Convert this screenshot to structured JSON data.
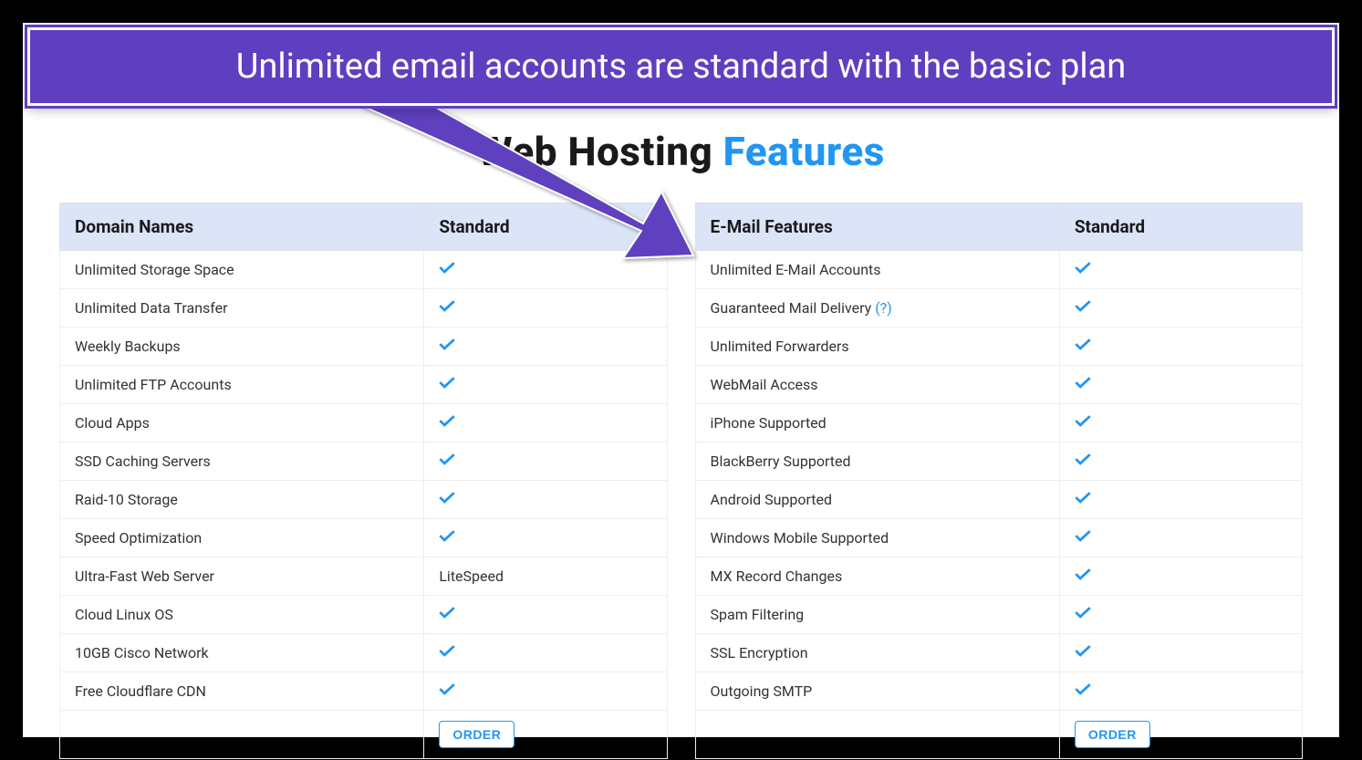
{
  "callout": {
    "text": "Unlimited email accounts are standard with the basic plan"
  },
  "title": {
    "part1": "Web Hosting ",
    "part2": "Features"
  },
  "help_token": "(?)",
  "tables": {
    "left": {
      "header_feature": "Domain Names",
      "header_plan": "Standard",
      "rows": [
        {
          "label": "Unlimited Storage Space",
          "value_type": "check",
          "value": ""
        },
        {
          "label": "Unlimited Data Transfer",
          "value_type": "check",
          "value": ""
        },
        {
          "label": "Weekly Backups",
          "value_type": "check",
          "value": ""
        },
        {
          "label": "Unlimited FTP Accounts",
          "value_type": "check",
          "value": ""
        },
        {
          "label": "Cloud Apps",
          "value_type": "check",
          "value": ""
        },
        {
          "label": "SSD Caching Servers",
          "value_type": "check",
          "value": ""
        },
        {
          "label": "Raid-10 Storage",
          "value_type": "check",
          "value": ""
        },
        {
          "label": "Speed Optimization",
          "value_type": "check",
          "value": ""
        },
        {
          "label": "Ultra-Fast Web Server",
          "value_type": "text",
          "value": "LiteSpeed"
        },
        {
          "label": "Cloud Linux OS",
          "value_type": "check",
          "value": ""
        },
        {
          "label": "10GB Cisco Network",
          "value_type": "check",
          "value": ""
        },
        {
          "label": "Free Cloudflare CDN",
          "value_type": "check",
          "value": ""
        }
      ],
      "order_label": "ORDER"
    },
    "right": {
      "header_feature": "E-Mail Features",
      "header_plan": "Standard",
      "rows": [
        {
          "label": "Unlimited E-Mail Accounts",
          "value_type": "check",
          "value": "",
          "has_help": false
        },
        {
          "label": "Guaranteed Mail Delivery ",
          "value_type": "check",
          "value": "",
          "has_help": true
        },
        {
          "label": "Unlimited Forwarders",
          "value_type": "check",
          "value": "",
          "has_help": false
        },
        {
          "label": "WebMail Access",
          "value_type": "check",
          "value": "",
          "has_help": false
        },
        {
          "label": "iPhone Supported",
          "value_type": "check",
          "value": "",
          "has_help": false
        },
        {
          "label": "BlackBerry Supported",
          "value_type": "check",
          "value": "",
          "has_help": false
        },
        {
          "label": "Android Supported",
          "value_type": "check",
          "value": "",
          "has_help": false
        },
        {
          "label": "Windows Mobile Supported",
          "value_type": "check",
          "value": "",
          "has_help": false
        },
        {
          "label": "MX Record Changes",
          "value_type": "check",
          "value": "",
          "has_help": false
        },
        {
          "label": "Spam Filtering",
          "value_type": "check",
          "value": "",
          "has_help": false
        },
        {
          "label": "SSL Encryption",
          "value_type": "check",
          "value": "",
          "has_help": false
        },
        {
          "label": "Outgoing SMTP",
          "value_type": "check",
          "value": "",
          "has_help": false
        }
      ],
      "order_label": "ORDER"
    }
  },
  "colors": {
    "banner_bg": "#5e3fbf",
    "accent_blue": "#2196f3",
    "header_bg": "#dbe5f7"
  }
}
